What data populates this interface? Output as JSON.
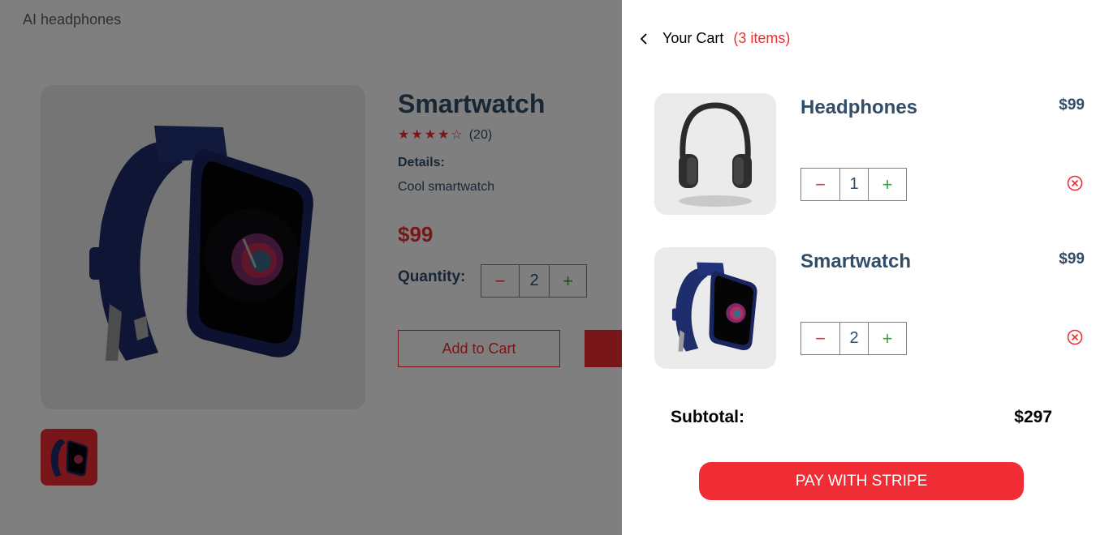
{
  "brand": "AI headphones",
  "product": {
    "title": "Smartwatch",
    "rating": 4,
    "rating_max": 5,
    "rating_count": "(20)",
    "details_label": "Details:",
    "details_text": "Cool smartwatch",
    "price": "$99",
    "quantity_label": "Quantity:",
    "quantity": "2",
    "minus_symbol": "−",
    "plus_symbol": "+",
    "add_to_cart": "Add to Cart",
    "images": [
      "smartwatch-image"
    ]
  },
  "cart": {
    "title": "Your Cart",
    "count": "(3 items)",
    "items": [
      {
        "name": "Headphones",
        "price": "$99",
        "quantity": "1",
        "image": "headphones-image"
      },
      {
        "name": "Smartwatch",
        "price": "$99",
        "quantity": "2",
        "image": "smartwatch-image"
      }
    ],
    "subtotal_label": "Subtotal:",
    "subtotal_value": "$297",
    "pay_button": "PAY WITH STRIPE"
  },
  "colors": {
    "accent": "#f02d34",
    "text": "#324d67",
    "plus": "#31a831",
    "image_bg": "#ebebeb"
  },
  "icons": {
    "back": "chevron-left-icon",
    "remove": "close-circle-icon",
    "star": "star-icon"
  }
}
